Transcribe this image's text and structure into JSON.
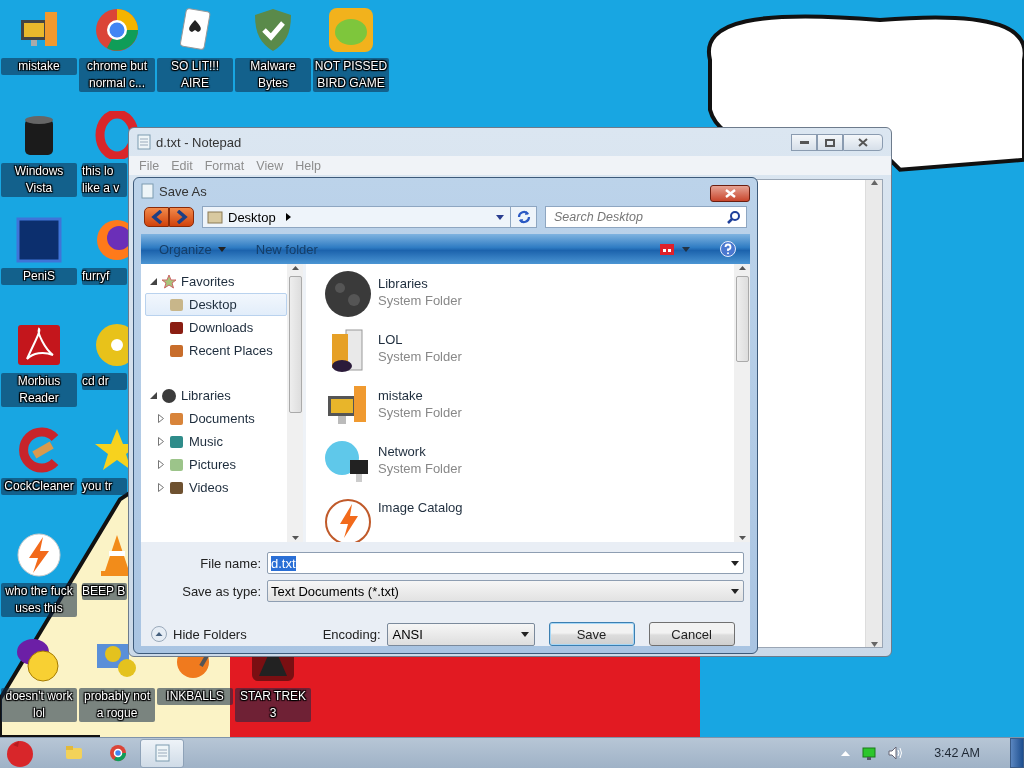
{
  "desktop": {
    "icons": [
      {
        "label": "mistake",
        "clipped": false
      },
      {
        "label": "chrome but normal c...",
        "clipped": false
      },
      {
        "label": "SO LIT!!! AIRE",
        "clipped": false
      },
      {
        "label": "Malware Bytes",
        "clipped": false
      },
      {
        "label": "NOT PISSED BIRD GAME",
        "clipped": false
      },
      {
        "label": "Windows Vista",
        "clipped": false
      },
      {
        "label": "this lo like a v",
        "clipped": true
      },
      {
        "label": "PeniS",
        "clipped": false
      },
      {
        "label": "furryf",
        "clipped": true
      },
      {
        "label": "Morbius Reader",
        "clipped": false
      },
      {
        "label": "cd dr",
        "clipped": true
      },
      {
        "label": "CockCleaner",
        "clipped": false
      },
      {
        "label": "you tr",
        "clipped": true
      },
      {
        "label": "who the fuck uses this",
        "clipped": false
      },
      {
        "label": "BEEP B",
        "clipped": true
      },
      {
        "label": "doesn't work lol",
        "clipped": false
      },
      {
        "label": "probably not a rogue",
        "clipped": false
      },
      {
        "label": "INKBALLS",
        "clipped": false
      },
      {
        "label": "STAR TREK 3",
        "clipped": false
      }
    ]
  },
  "notepad": {
    "title": "d.txt - Notepad",
    "menu": [
      {
        "label": "File",
        "disabled": true
      },
      {
        "label": "Edit",
        "disabled": true
      },
      {
        "label": "Format",
        "disabled": true
      },
      {
        "label": "View",
        "disabled": true
      },
      {
        "label": "Help",
        "disabled": true
      }
    ]
  },
  "save_dialog": {
    "title": "Save As",
    "address": "Desktop",
    "search": {
      "placeholder": "Search Desktop"
    },
    "toolbar": {
      "organize": "Organize",
      "new_folder": "New folder"
    },
    "nav_tree": [
      {
        "label": "Favorites",
        "expanded": true,
        "selected": false,
        "children": [
          {
            "label": "Desktop",
            "selected": true
          },
          {
            "label": "Downloads",
            "selected": false
          },
          {
            "label": "Recent Places",
            "selected": false
          }
        ]
      },
      {
        "label": "Libraries",
        "expanded": true,
        "selected": false,
        "children": [
          {
            "label": "Documents",
            "expanded": false,
            "selected": false
          },
          {
            "label": "Music",
            "expanded": false,
            "selected": false
          },
          {
            "label": "Pictures",
            "expanded": false,
            "selected": false
          },
          {
            "label": "Videos",
            "expanded": false,
            "selected": false
          }
        ]
      }
    ],
    "files": [
      {
        "name": "Libraries",
        "type": "System Folder"
      },
      {
        "name": "LOL",
        "type": "System Folder"
      },
      {
        "name": "mistake",
        "type": "System Folder"
      },
      {
        "name": "Network",
        "type": "System Folder"
      },
      {
        "name": "Image Catalog"
      }
    ],
    "file_name": {
      "label": "File name:",
      "value": "d.txt",
      "selected": true
    },
    "save_as_type": {
      "label": "Save as type:",
      "value": "Text Documents (*.txt)"
    },
    "hide_folders": "Hide Folders",
    "encoding": {
      "label": "Encoding:",
      "value": "ANSI"
    },
    "buttons": [
      {
        "label": "Save",
        "default": true
      },
      {
        "label": "Cancel",
        "default": false
      }
    ]
  },
  "taskbar": {
    "pinned": [
      {
        "active": false
      },
      {
        "active": false
      },
      {
        "active": true
      }
    ],
    "clock": "3:42 AM"
  }
}
